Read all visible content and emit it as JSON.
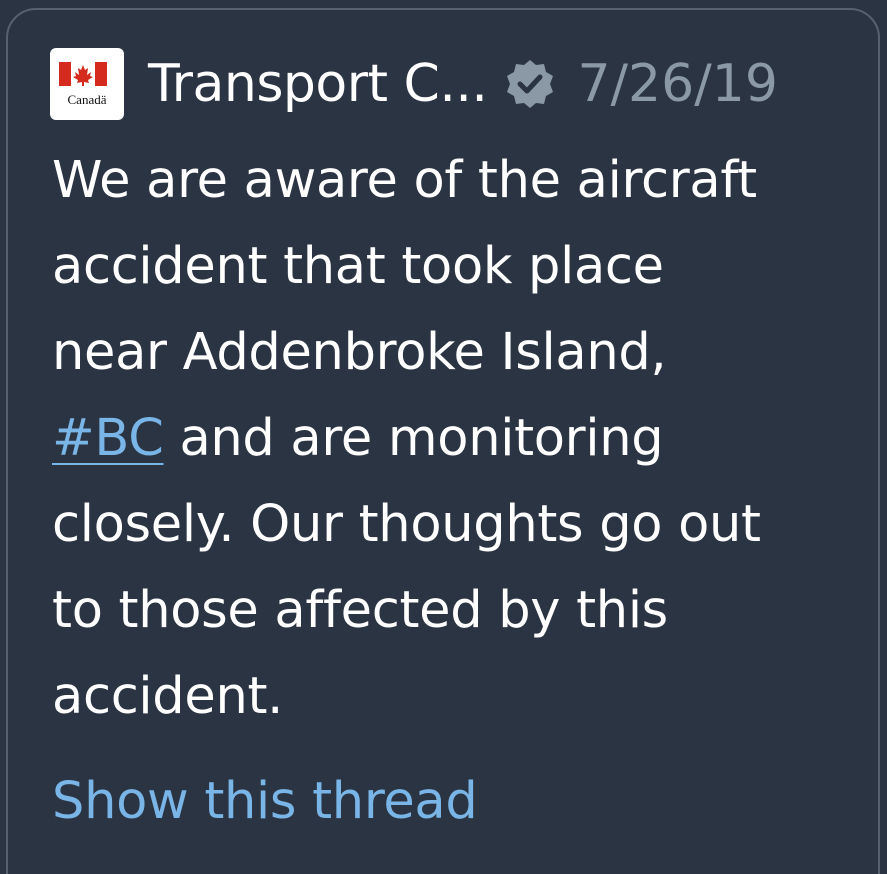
{
  "tweet": {
    "author_name": "Transport C...",
    "avatar_wordmark": "Canadä",
    "verified_icon": "verified-badge-icon",
    "date": "7/26/19",
    "text_lines": {
      "l1": "We are aware of the aircraft",
      "l2": "accident that took place",
      "l3": "near Addenbroke Island,",
      "l4_hashtag": "#BC",
      "l4_rest": " and are monitoring",
      "l5": "closely. Our thoughts go out",
      "l6": "to those affected by this",
      "l7": "accident."
    },
    "show_thread": "Show this thread"
  },
  "colors": {
    "background": "#2a3442",
    "border": "#56616e",
    "text": "#ffffff",
    "muted": "#8b98a5",
    "link": "#7ab5e8",
    "flag_red": "#d52b1e"
  }
}
